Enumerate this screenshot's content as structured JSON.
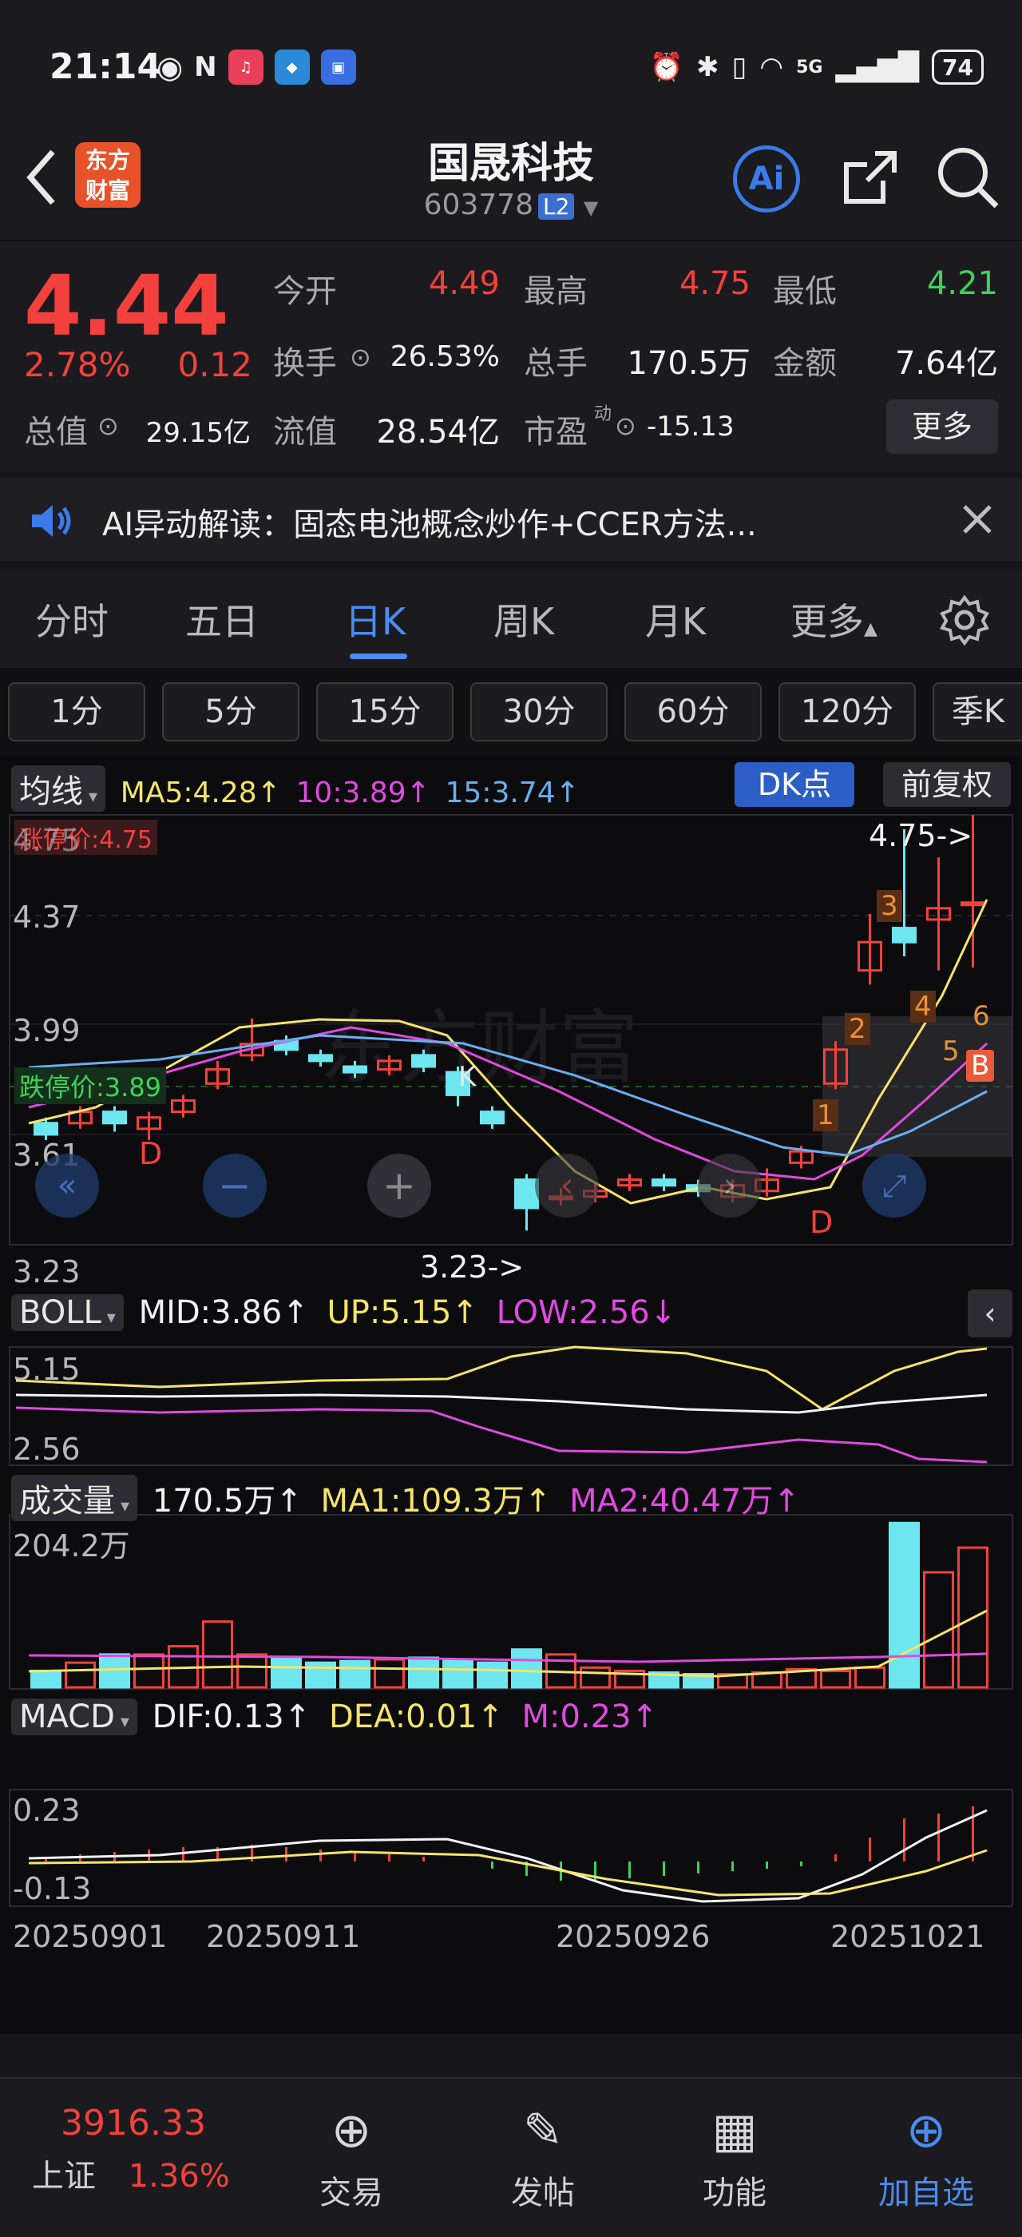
{
  "status_bar": {
    "time": "21:14",
    "network": "5G",
    "battery": "74"
  },
  "header": {
    "stock_name": "国晟科技",
    "stock_code": "603778",
    "level_badge": "L2",
    "logo_text": [
      "东方",
      "财富"
    ],
    "ai_label": "Ai"
  },
  "quote": {
    "price": "4.44",
    "change_pct": "2.78%",
    "change_amt": "0.12",
    "open_label": "今开",
    "open": "4.49",
    "high_label": "最高",
    "high": "4.75",
    "low_label": "最低",
    "low": "4.21",
    "turnover_label": "换手",
    "turnover": "26.53%",
    "volume_label": "总手",
    "volume": "170.5万",
    "amount_label": "金额",
    "amount": "7.64亿",
    "total_mv_label": "总值",
    "total_mv": "29.15亿",
    "float_mv_label": "流值",
    "float_mv": "28.54亿",
    "pe_label": "市盈",
    "pe_sup": "动",
    "pe": "-15.13",
    "more_label": "更多"
  },
  "ai_banner": {
    "text": "AI异动解读：固态电池概念炒作+CCER方法..."
  },
  "tabs": [
    "分时",
    "五日",
    "日K",
    "周K",
    "月K",
    "更多"
  ],
  "active_tab": 2,
  "period_buttons": [
    "1分",
    "5分",
    "15分",
    "30分",
    "60分",
    "120分",
    "季K"
  ],
  "ma_bar": {
    "selector": "均线",
    "ma5": "MA5:4.28↑",
    "ma10": "10:3.89↑",
    "ma15": "15:3.74↑",
    "dk_label": "DK点",
    "adjust_label": "前复权"
  },
  "kline_labels": {
    "limit_up": "涨停价:4.75",
    "limit_down": "跌停价:3.89",
    "y_top": "4.75",
    "y_2": "4.37",
    "y_3": "3.99",
    "y_4": "3.61",
    "y_bottom": "3.23",
    "max_marker": "4.75->",
    "min_marker": "3.23->",
    "signal_d": "D",
    "signal_b": "B",
    "signal_k": "K",
    "watermark": "东方财富",
    "markers": [
      "1",
      "2",
      "3",
      "4",
      "5",
      "6"
    ]
  },
  "boll_bar": {
    "selector": "BOLL",
    "mid": "MID:3.86↑",
    "up": "UP:5.15↑",
    "low": "LOW:2.56↓",
    "y_top": "5.15",
    "y_bottom": "2.56"
  },
  "vol_bar": {
    "selector": "成交量",
    "vol": "170.5万↑",
    "ma1": "MA1:109.3万↑",
    "ma2": "MA2:40.47万↑",
    "y_top": "204.2万"
  },
  "macd_bar": {
    "selector": "MACD",
    "dif": "DIF:0.13↑",
    "dea": "DEA:0.01↑",
    "m": "M:0.23↑",
    "y_top": "0.23",
    "y_bottom": "-0.13"
  },
  "dates": [
    "20250901",
    "20250911",
    "20250926",
    "20251021"
  ],
  "bottom_nav": {
    "index_value": "3916.33",
    "index_name": "上证",
    "index_change": "1.36%",
    "items": [
      "交易",
      "发帖",
      "功能",
      "加自选"
    ]
  },
  "colors": {
    "up": "#f2413c",
    "down": "#3fd25a",
    "accent": "#4c8cf0",
    "ma5": "#f5e46a",
    "ma10": "#e04ae0",
    "ma15": "#6aaef0",
    "cyan": "#6de6f0"
  }
}
